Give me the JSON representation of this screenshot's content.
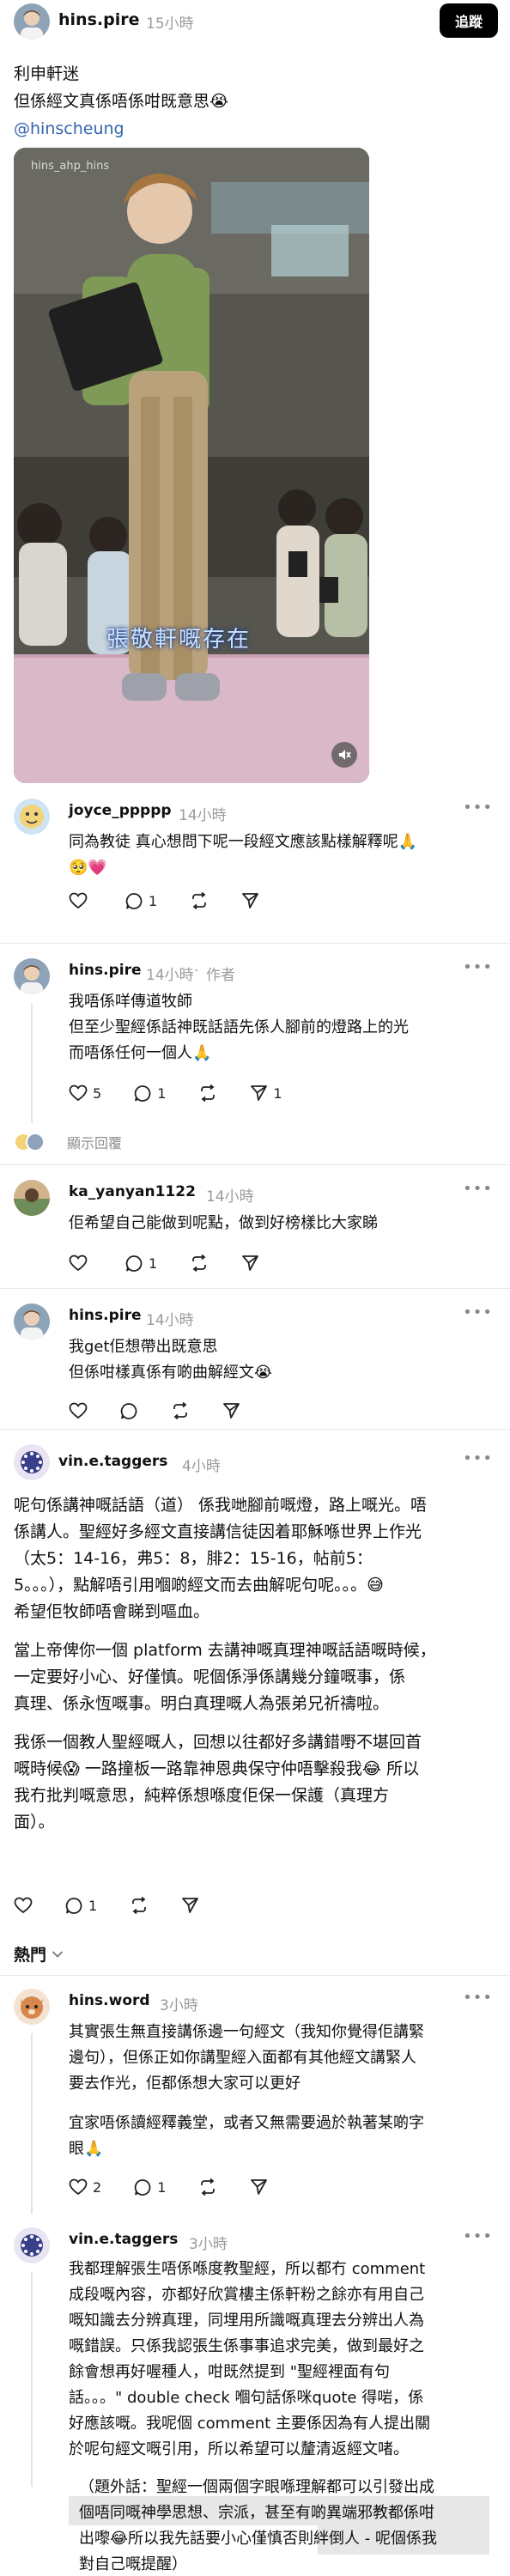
{
  "post": {
    "username": "hins.pire",
    "time": "15小時",
    "follow_label": "追蹤",
    "text_line1": "利申軒迷",
    "text_line2": "但係經文真係唔係咁既意思😭",
    "mention": "@hinscheung",
    "media": {
      "watermark": "hins_ahp_hins",
      "caption": "張敬軒嘅存在",
      "mute_icon": "speaker-muted-icon"
    }
  },
  "comments": [
    {
      "username": "joyce_ppppp",
      "time": "14小時",
      "text_lines": [
        "同為教徒 真心想問下呢一段經文應該點樣解釋呢🙏",
        "🥺💗"
      ],
      "likes": "",
      "replies": "1"
    },
    {
      "username": "hins.pire",
      "time": "14小時",
      "author_tag": "作者",
      "text_lines": [
        "我唔係咩傳道牧師",
        "但至少聖經係話神既話語先係人腳前的燈路上的光",
        "而唔係任何一個人🙏"
      ],
      "likes": "5",
      "replies": "1",
      "shares": "1"
    },
    {
      "username": "ka_yanyan1122",
      "time": "14小時",
      "text_lines": [
        "佢希望自己能做到呢點，做到好榜樣比大家睇"
      ],
      "likes": "",
      "replies": "1"
    },
    {
      "username": "hins.pire",
      "time": "14小時",
      "text_lines": [
        "我get佢想帶出既意思",
        "但係咁樣真係有啲曲解經文😭"
      ],
      "likes": "",
      "replies": ""
    },
    {
      "username": "vin.e.taggers",
      "time": "4小時",
      "paragraphs": [
        [
          "呢句係講神嘅話語（道） 係我哋腳前嘅燈，路上嘅光。唔",
          "係講人。聖經好多經文直接講信徒因着耶穌喺世界上作光",
          "（太5：14-16，弗5：8，腓2：15-16，帖前5：",
          "5。。。），點解唔引用嗰啲經文而去曲解呢句呢。。。😅",
          "希望佢牧師唔會睇到嘔血。"
        ],
        [
          "當上帝俾你一個 platform 去講神嘅真理神嘅話語嘅時候，",
          "一定要好小心、好僅慎。呢個係淨係講幾分鐘嘅事，係",
          "真理、係永恆嘅事。明白真理嘅人為張弟兄祈禱啦。"
        ],
        [
          "我係一個教人聖經嘅人，回想以往都好多講錯嘢不堪回首",
          "嘅時候😱 一路撞板一路靠神恩典保守仲唔擊殺我😂 所以",
          "我冇批判嘅意思，純粹係想喺度佢保一保護（真理方",
          "面）。"
        ]
      ],
      "likes": "",
      "replies": "1"
    },
    {
      "username": "hins.word",
      "time": "3小時",
      "paragraphs": [
        [
          "其實張生無直接講係邊一句經文（我知你覺得佢講緊",
          "邊句），但係正如你講聖經入面都有其他經文講緊人",
          "要去作光，佢都係想大家可以更好"
        ],
        [
          "宜家唔係讀經釋義堂，或者又無需要過於執著某啲字",
          "眼🙏"
        ]
      ],
      "likes": "2",
      "replies": "1"
    },
    {
      "username": "vin.e.taggers",
      "time": "3小時",
      "paragraphs": [
        [
          "我都理解張生唔係喺度教聖經，所以都冇 comment",
          "成段嘅內容，亦都好欣賞樓主係軒粉之餘亦有用自己",
          "嘅知識去分辨真理，同埋用所識嘅真理去分辨出人為",
          "嘅錯誤。只係我認張生係事事追求完美，做到最好之",
          "餘會想再好喔種人，咁既然提到 \"聖經裡面有句",
          "話。。。\" double check 嗰句話係咪quote 得啱，係",
          "好應該嘅。我呢個 comment 主要係因為有人提出關",
          "於呢句經文嘅引用，所以希望可以釐清返經文啫。"
        ],
        [
          "（題外話：聖經一個兩個字眼喺理解都可以引發出成",
          "個唔同嘅神學思想、宗派，甚至有啲異端邪教都係咁",
          "出嚟😂所以我先話要小心僅慎否則絆倒人 - 呢個係我",
          "對自己嘅提醒）"
        ]
      ]
    }
  ],
  "show_replies_label": "顯示回覆",
  "sort_label": "熱門",
  "icons": {
    "like": "heart-icon",
    "reply": "comment-bubble-icon",
    "repost": "repost-icon",
    "share": "send-icon",
    "more": "more-dots-icon",
    "sort": "chevron-down-icon"
  }
}
